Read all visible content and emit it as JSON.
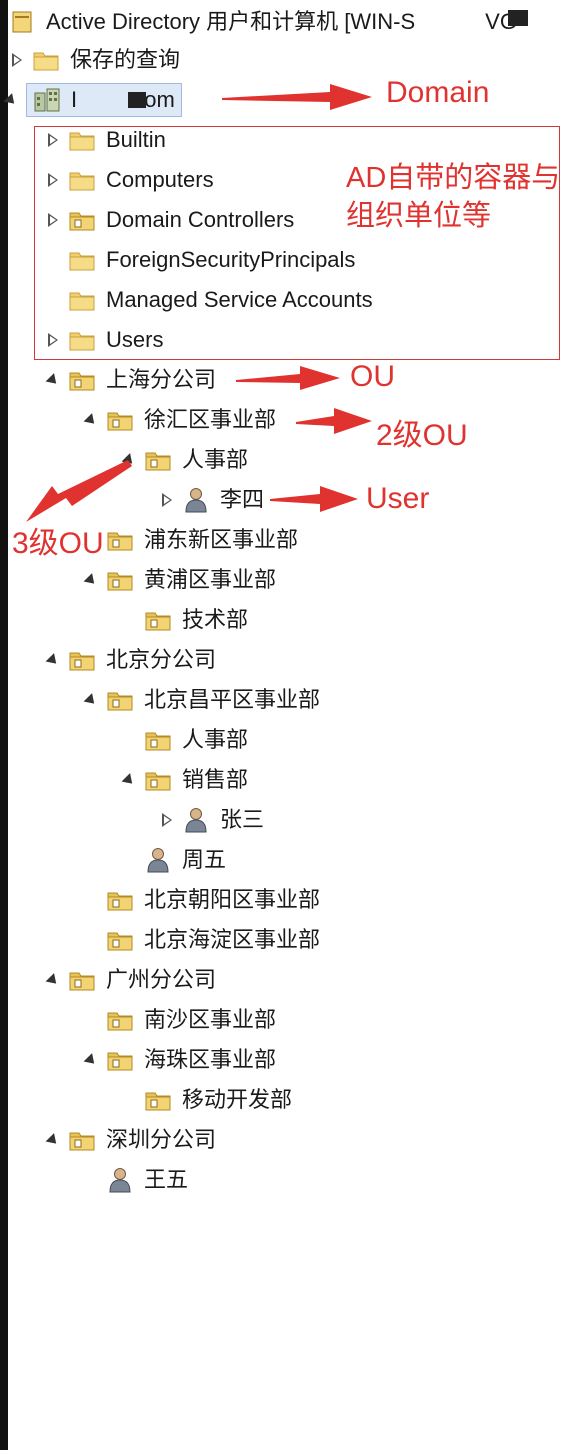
{
  "window": {
    "title_prefix": "Active Directory 用户和计算机 [WIN-S",
    "title_suffix": "VG"
  },
  "tree": {
    "saved_queries": "保存的查询",
    "domain": {
      "prefix": "I",
      "suffix": ".com"
    },
    "containers": [
      "Builtin",
      "Computers",
      "Domain Controllers",
      "ForeignSecurityPrincipals",
      "Managed Service Accounts",
      "Users"
    ],
    "shanghai": "上海分公司",
    "xuhui": "徐汇区事业部",
    "xuhui_hr": "人事部",
    "lisi": "李四",
    "pudong": "浦东新区事业部",
    "huangpu": "黄浦区事业部",
    "tech": "技术部",
    "beijing": "北京分公司",
    "changping": "北京昌平区事业部",
    "changping_hr": "人事部",
    "sales": "销售部",
    "zhangsan": "张三",
    "zhouwu": "周五",
    "chaoyang": "北京朝阳区事业部",
    "haidian": "北京海淀区事业部",
    "guangzhou": "广州分公司",
    "nansha": "南沙区事业部",
    "haizhu": "海珠区事业部",
    "mobile_dev": "移动开发部",
    "shenzhen": "深圳分公司",
    "wangwu": "王五"
  },
  "annotations": {
    "domain": "Domain",
    "containers_line1": "AD自带的容器与",
    "containers_line2": "组织单位等",
    "ou": "OU",
    "ou2": "2级OU",
    "user": "User",
    "ou3": "3级OU"
  },
  "colors": {
    "annotation": "#e0322f",
    "folder": "#f2cf6e",
    "ou_folder": "#e6c25a",
    "user": "#7a8696"
  },
  "icons": {
    "folder": "folder-icon",
    "ou": "ou-folder-icon",
    "user": "user-icon",
    "domain": "domain-icon"
  }
}
